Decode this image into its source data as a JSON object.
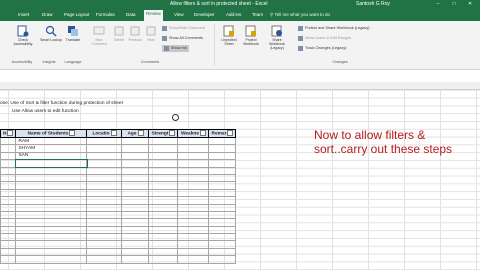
{
  "window": {
    "title": "Allow filters & sort in protected sheet - Excel",
    "user": "Santosh G Roy",
    "controls": [
      "–",
      "□",
      "✕"
    ]
  },
  "ribbon_tabs": [
    {
      "label": "Insert"
    },
    {
      "label": "Draw"
    },
    {
      "label": "Page Layout"
    },
    {
      "label": "Formulas"
    },
    {
      "label": "Data"
    },
    {
      "label": "Review"
    },
    {
      "label": "View"
    },
    {
      "label": "Developer"
    },
    {
      "label": "Add-ins"
    },
    {
      "label": "Team"
    }
  ],
  "active_tab": "Review",
  "tell_me": "Tell me what you want to do",
  "ribbon": {
    "check_accessibility": "Check Accessibility",
    "smart_lookup": "Smart Lookup",
    "translate": "Translate",
    "new_comment": "New Comment",
    "delete": "Delete",
    "previous": "Previous",
    "next": "Next",
    "show_hide_comment": "Show/Hide Comment",
    "show_all_comments": "Show All Comments",
    "show_ink": "Show Ink",
    "unprotect_sheet": "Unprotect Sheet",
    "protect_workbook": "Protect Workbook",
    "share_workbook": "Share Workbook (Legacy)",
    "protect_share": "Protect and Share Workbook (Legacy)",
    "allow_edit_ranges": "Allow Users to Edit Ranges",
    "track_changes": "Track Changes (Legacy)",
    "groups": {
      "accessibility": "Accessibility",
      "insights": "Insights",
      "language": "Language",
      "comments": "Comments",
      "changes": "Changes"
    }
  },
  "notes": {
    "purpose": "ose:  Use of Sort & filter function during protection of sheet",
    "method": "Use Allow users to edit function"
  },
  "table": {
    "headers": [
      "N",
      "Name of Students",
      "Locatio",
      "Age",
      "Strengt",
      "Weakne",
      "Remar"
    ],
    "rows": [
      [
        "",
        "RAM",
        "",
        "",
        "",
        "",
        ""
      ],
      [
        "",
        "SHYAM",
        "",
        "",
        "",
        "",
        ""
      ],
      [
        "",
        "SAN",
        "",
        "",
        "",
        "",
        ""
      ],
      [
        "",
        "",
        "",
        "",
        "",
        "",
        ""
      ],
      [
        "",
        "",
        "",
        "",
        "",
        "",
        ""
      ],
      [
        "",
        "",
        "",
        "",
        "",
        "",
        ""
      ],
      [
        "",
        "",
        "",
        "",
        "",
        "",
        ""
      ],
      [
        "",
        "",
        "",
        "",
        "",
        "",
        ""
      ],
      [
        "",
        "",
        "",
        "",
        "",
        "",
        ""
      ],
      [
        "",
        "",
        "",
        "",
        "",
        "",
        ""
      ],
      [
        "",
        "",
        "",
        "",
        "",
        "",
        ""
      ],
      [
        "",
        "",
        "",
        "",
        "",
        "",
        ""
      ],
      [
        "",
        "",
        "",
        "",
        "",
        "",
        ""
      ],
      [
        "",
        "",
        "",
        "",
        "",
        "",
        ""
      ],
      [
        "",
        "",
        "",
        "",
        "",
        "",
        ""
      ],
      [
        "",
        "",
        "",
        "",
        "",
        "",
        ""
      ],
      [
        "",
        "",
        "",
        "",
        "",
        "",
        ""
      ]
    ]
  },
  "overlay_text": "Now to allow filters & sort..carry out these steps",
  "colors": {
    "excel_green": "#217346",
    "header_fill": "#d9e2f0",
    "overlay_red": "#b71c1c"
  }
}
